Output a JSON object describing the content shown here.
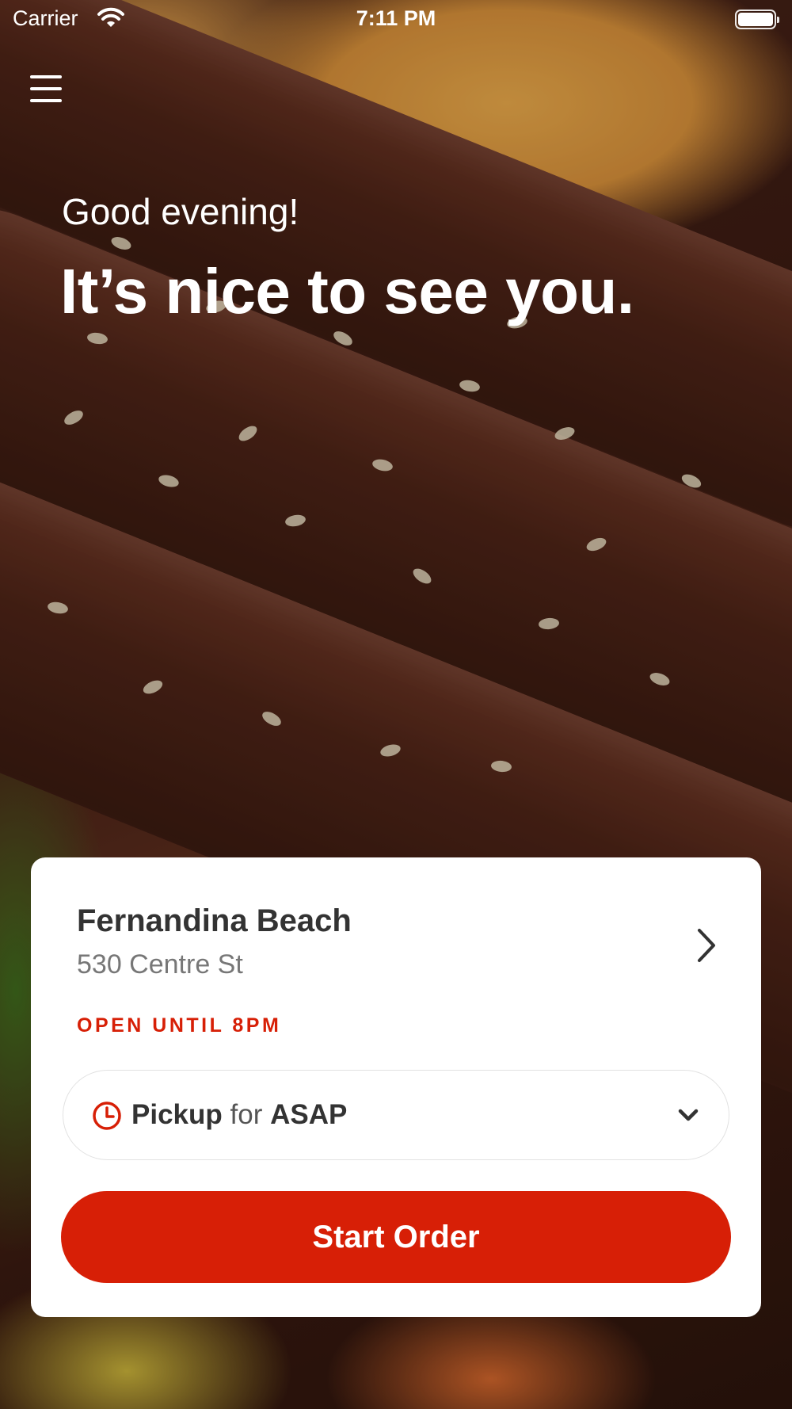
{
  "status_bar": {
    "carrier": "Carrier",
    "time": "7:11 PM",
    "wifi_icon": "wifi-icon",
    "battery_icon": "battery-icon",
    "battery_level": 1.0
  },
  "header": {
    "menu_icon": "hamburger-menu-icon",
    "greeting": "Good evening!",
    "headline": "It’s nice to see you."
  },
  "location_card": {
    "name": "Fernandina Beach",
    "address": "530 Centre St",
    "hours": "OPEN UNTIL 8PM",
    "chevron_icon": "chevron-right-icon"
  },
  "order_mode": {
    "icon": "clock-icon",
    "mode": "Pickup",
    "connector": "for",
    "time": "ASAP",
    "dropdown_icon": "chevron-down-icon"
  },
  "start_button": {
    "label": "Start Order"
  },
  "colors": {
    "accent": "#d71f06",
    "card_background": "#ffffff",
    "title_text": "#333333",
    "secondary_text": "#777777"
  }
}
